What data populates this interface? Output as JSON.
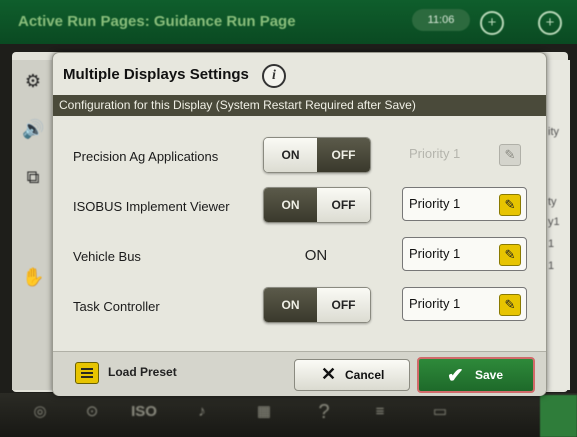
{
  "background": {
    "title": "Active Run Pages: Guidance Run Page",
    "clock": "11:06",
    "left_icons": [
      "settings-icon",
      "speaker-icon",
      "displays-icon",
      "hand-icon"
    ],
    "right_fragments": [
      "ity",
      "ty",
      "y1",
      "1",
      "1"
    ],
    "dock_items": [
      "Gauge",
      "ISO",
      "Audio",
      "?",
      "Status"
    ]
  },
  "dialog": {
    "title": "Multiple Displays Settings",
    "subheader": "Configuration for this Display  (System Restart Required after Save)",
    "rows": [
      {
        "label": "Precision Ag Applications",
        "state": "OFF",
        "on": "ON",
        "off": "OFF",
        "priority": "Priority 1",
        "priority_enabled": false
      },
      {
        "label": "ISOBUS Implement Viewer",
        "state": "ON",
        "on": "ON",
        "off": "OFF",
        "priority": "Priority 1",
        "priority_enabled": true
      },
      {
        "label": "Vehicle Bus",
        "state_text": "ON",
        "priority": "Priority 1",
        "priority_enabled": true
      },
      {
        "label": "Task Controller",
        "state": "ON",
        "on": "ON",
        "off": "OFF",
        "priority": "Priority 1",
        "priority_enabled": true
      }
    ],
    "footer": {
      "load_preset": "Load Preset",
      "cancel": "Cancel",
      "save": "Save"
    }
  },
  "colors": {
    "accent_yellow": "#e7c400",
    "save_green": "#2e8a3a",
    "header_dark": "#4a4a3a"
  }
}
